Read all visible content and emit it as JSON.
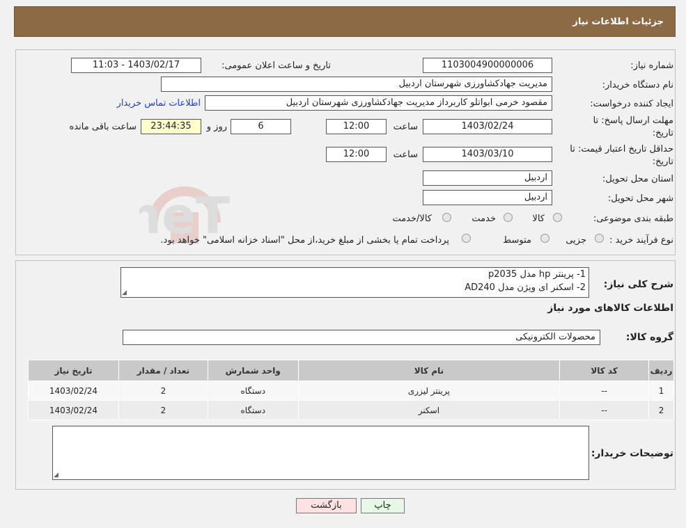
{
  "header": {
    "title": "جزئیات اطلاعات نیاز"
  },
  "form": {
    "need_number_label": "شماره نیاز:",
    "need_number": "1103004900000006",
    "announce_label": "تاریخ و ساعت اعلان عمومی:",
    "announce_value": "1403/02/17 - 11:03",
    "buyer_org_label": "نام دستگاه خریدار:",
    "buyer_org": "مدیریت جهادکشاورزی شهرستان اردبیل",
    "requester_label": "ایجاد کننده درخواست:",
    "requester": "مقصود خرمی ابواتلو کاربرداز مدیریت جهادکشاورزی شهرستان اردبیل",
    "contact_link": "اطلاعات تماس خریدار",
    "deadline_label": "مهلت ارسال پاسخ: تا تاریخ:",
    "deadline_date": "1403/02/24",
    "time_label": "ساعت",
    "deadline_time": "12:00",
    "days_value": "6",
    "days_label": "روز و",
    "remaining_time": "23:44:35",
    "remaining_label": "ساعت باقی مانده",
    "validity_label": "حداقل تاریخ اعتبار قیمت: تا تاریخ:",
    "validity_date": "1403/03/10",
    "validity_time": "12:00",
    "province_label": "استان محل تحویل:",
    "province": "اردبیل",
    "city_label": "شهر محل تحویل:",
    "city": "اردبیل",
    "category_label": "طبقه بندی موضوعی:",
    "category_options": [
      "کالا",
      "خدمت",
      "کالا/خدمت"
    ],
    "process_label": "نوع فرآیند خرید :",
    "process_options": [
      "جزیی",
      "متوسط"
    ],
    "process_note": "پرداخت تمام یا بخشی از مبلغ خرید،از محل \"اسناد خزانه اسلامی\" خواهد بود."
  },
  "description": {
    "label": "شرح کلی نیاز:",
    "line1": "1- پرینتر hp مدل p2035",
    "line2": "2- اسکنر ای ویژن مدل AD240"
  },
  "goods": {
    "section_title": "اطلاعات کالاهای مورد نیاز",
    "group_label": "گروه کالا:",
    "group_value": "محصولات الکترونیکی",
    "headers": [
      "ردیف",
      "کد کالا",
      "نام کالا",
      "واحد شمارش",
      "تعداد / مقدار",
      "تاریخ نیاز"
    ],
    "rows": [
      [
        "1",
        "--",
        "پرینتر لیزری",
        "دستگاه",
        "2",
        "1403/02/24"
      ],
      [
        "2",
        "--",
        "اسکنر",
        "دستگاه",
        "2",
        "1403/02/24"
      ]
    ]
  },
  "buyer_notes": {
    "label": "توضیحات خریدار:",
    "value": ""
  },
  "buttons": {
    "print": "چاپ",
    "back": "بازگشت"
  },
  "watermark": {
    "text": "AriaTender.neT"
  }
}
